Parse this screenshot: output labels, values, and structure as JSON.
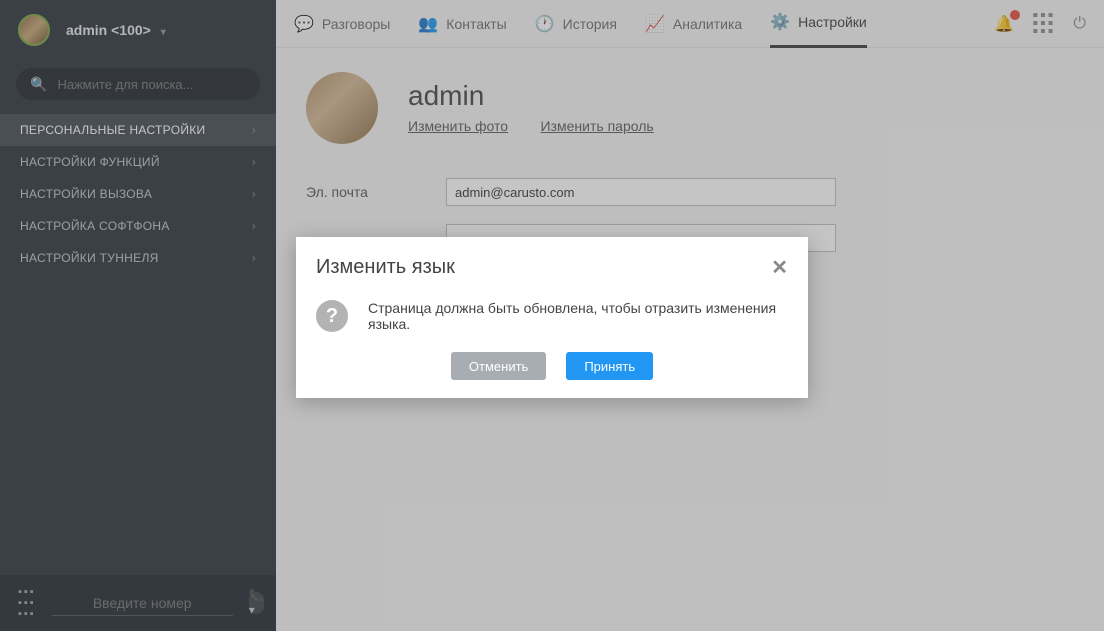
{
  "sidebar": {
    "user": "admin <100>",
    "searchPlaceholder": "Нажмите для поиска...",
    "nav": [
      {
        "label": "ПЕРСОНАЛЬНЫЕ НАСТРОЙКИ",
        "active": true
      },
      {
        "label": "НАСТРОЙКИ ФУНКЦИЙ",
        "active": false
      },
      {
        "label": "НАСТРОЙКИ ВЫЗОВА",
        "active": false
      },
      {
        "label": "НАСТРОЙКА СОФТФОНА",
        "active": false
      },
      {
        "label": "НАСТРОЙКИ ТУННЕЛЯ",
        "active": false
      }
    ],
    "dialPlaceholder": "Введите номер"
  },
  "topnav": {
    "items": [
      {
        "label": "Разговоры"
      },
      {
        "label": "Контакты"
      },
      {
        "label": "История"
      },
      {
        "label": "Аналитика"
      },
      {
        "label": "Настройки"
      }
    ]
  },
  "profile": {
    "name": "admin",
    "changePhoto": "Изменить фото",
    "changePassword": "Изменить пароль"
  },
  "form": {
    "emailLabel": "Эл. почта",
    "emailValue": "admin@carusto.com"
  },
  "modal": {
    "title": "Изменить язык",
    "message": "Страница должна быть обновлена, чтобы отразить изменения языка.",
    "cancel": "Отменить",
    "accept": "Принять"
  }
}
